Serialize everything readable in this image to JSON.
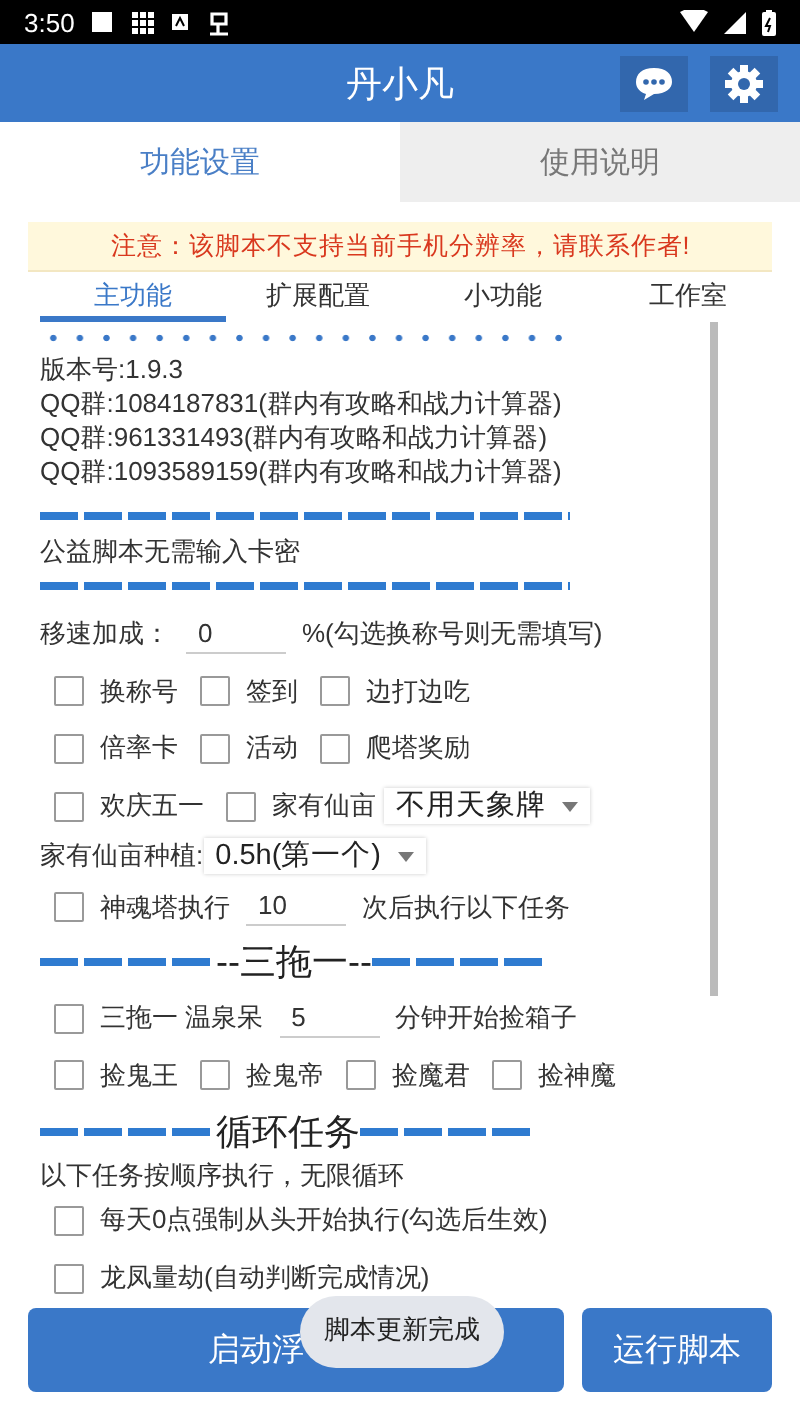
{
  "status_bar": {
    "time": "3:50"
  },
  "app_bar": {
    "title": "丹小凡"
  },
  "tabs": [
    {
      "label": "功能设置",
      "selected": true
    },
    {
      "label": "使用说明",
      "selected": false
    }
  ],
  "notice": "注意：该脚本不支持当前手机分辨率，请联系作者!",
  "sub_tabs": [
    {
      "label": "主功能",
      "selected": true
    },
    {
      "label": "扩展配置",
      "selected": false
    },
    {
      "label": "小功能",
      "selected": false
    },
    {
      "label": "工作室",
      "selected": false
    }
  ],
  "info_lines": [
    "版本号:1.9.3",
    "QQ群:1084187831(群内有攻略和战力计算器)",
    "QQ群:961331493(群内有攻略和战力计算器)",
    "QQ群:1093589159(群内有攻略和战力计算器)"
  ],
  "note": "公益脚本无需输入卡密",
  "settings": [
    {
      "kind": "input",
      "label": "移速加成：",
      "value": "0",
      "suffix": "%(勾选换称号则无需填写)"
    },
    {
      "kind": "checks",
      "items": [
        {
          "label": "换称号",
          "checked": false
        },
        {
          "label": "签到",
          "checked": false
        },
        {
          "label": "边打边吃",
          "checked": false
        }
      ]
    },
    {
      "kind": "checks",
      "items": [
        {
          "label": "倍率卡",
          "checked": false
        },
        {
          "label": "活动",
          "checked": false
        },
        {
          "label": "爬塔奖励",
          "checked": false
        }
      ]
    },
    {
      "kind": "checks",
      "items": [
        {
          "label": "欢庆五一",
          "checked": false
        },
        {
          "label": "家有仙亩",
          "checked": false
        }
      ],
      "select": "不用天象牌"
    },
    {
      "kind": "select",
      "label": "家有仙亩种植:",
      "value": "0.5h(第一个)"
    },
    {
      "kind": "check_input",
      "checked": false,
      "label": "神魂塔执行",
      "value": "10",
      "suffix": "次后执行以下任务"
    },
    {
      "kind": "section",
      "title": "--三拖一--"
    },
    {
      "kind": "check_input",
      "checked": false,
      "label": "三拖一 温泉呆",
      "value": "5",
      "suffix": "分钟开始捡箱子"
    },
    {
      "kind": "checks",
      "items": [
        {
          "label": "捡鬼王",
          "checked": false
        },
        {
          "label": "捡鬼帝",
          "checked": false
        },
        {
          "label": "捡魔君",
          "checked": false
        },
        {
          "label": "捡神魔",
          "checked": false
        }
      ]
    },
    {
      "kind": "section",
      "title": "循环任务"
    },
    {
      "kind": "text",
      "text": "以下任务按顺序执行，无限循环"
    },
    {
      "kind": "checks",
      "items": [
        {
          "label": "每天0点强制从头开始执行(勾选后生效)",
          "checked": false
        }
      ]
    },
    {
      "kind": "checks",
      "items": [
        {
          "label": "龙凤量劫(自动判断完成情况)",
          "checked": false
        }
      ]
    }
  ],
  "buttons": [
    "启动浮",
    "运行脚本"
  ],
  "toast": "脚本更新完成"
}
